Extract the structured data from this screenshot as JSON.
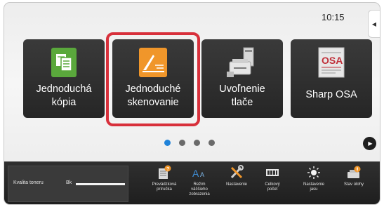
{
  "status": {
    "time": "10:15"
  },
  "tiles": [
    {
      "label": "Jednoduchá\nkópia",
      "icon": "copy-icon"
    },
    {
      "label": "Jednoduché\nskenovanie",
      "icon": "scan-icon"
    },
    {
      "label": "Uvoľnenie\ntlače",
      "icon": "print-release-icon"
    },
    {
      "label": "Sharp OSA",
      "icon": "sharp-osa-icon"
    }
  ],
  "selected_tile": "Jednoduché skenovanie",
  "pagination": {
    "pages": 4,
    "current": 1
  },
  "toner": {
    "label": "Kvalita toneru",
    "color_label": "Bk",
    "level": 1.0
  },
  "bottom_items": [
    {
      "label": "Prevádzková\npríručka",
      "icon": "manual-icon"
    },
    {
      "label": "Režim\nväčšieho\nzobrazenia",
      "icon": "large-display-icon"
    },
    {
      "label": "Nastavenie",
      "icon": "settings-tools-icon"
    },
    {
      "label": "Celkový\npočet",
      "icon": "counter-icon"
    },
    {
      "label": "Nastavenie\njasu",
      "icon": "brightness-icon"
    },
    {
      "label": "Stav úlohy",
      "icon": "job-status-icon"
    }
  ],
  "colors": {
    "highlight": "#d8303b",
    "active_dot": "#1f82d9",
    "copy_icon_green": "#5aa83c",
    "scan_icon_orange": "#f0962a"
  }
}
